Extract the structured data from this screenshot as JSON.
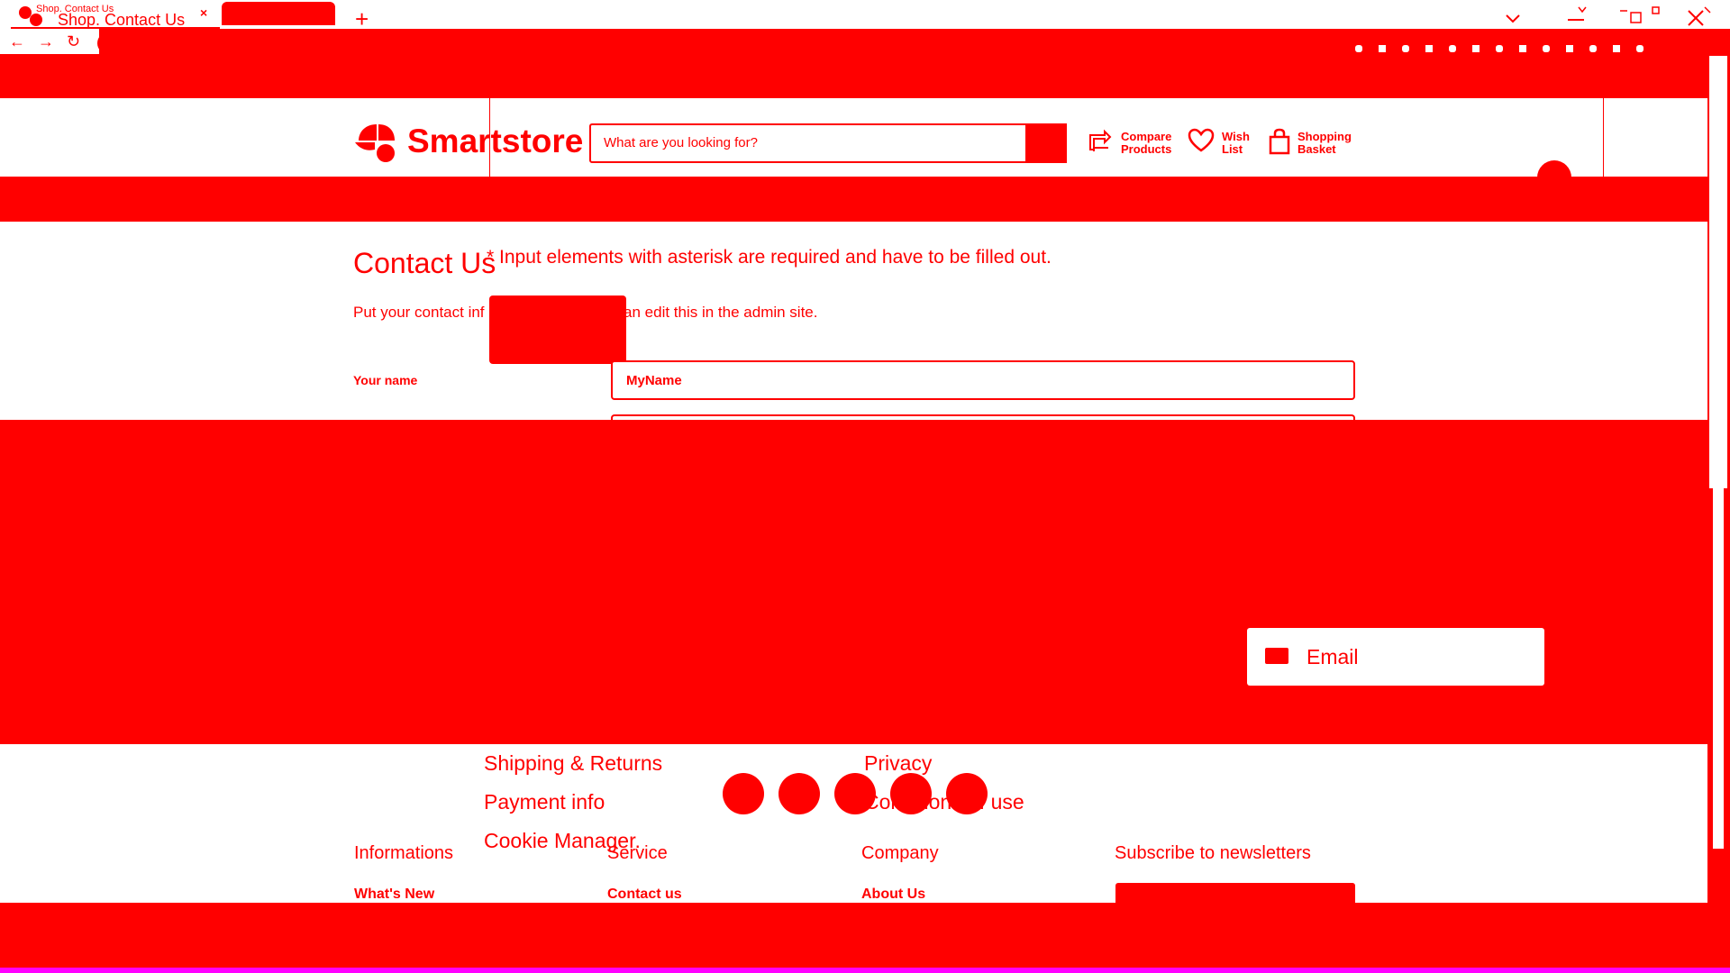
{
  "browser": {
    "tab_title_small": "Shop. Contact Us",
    "tab_title": "Shop. Contact Us",
    "tab_close": "×",
    "new_tab": "+",
    "back": "←",
    "forward": "→",
    "reload": "↻"
  },
  "header": {
    "logo_text": "Smartstore",
    "search_placeholder": "What are you looking for?",
    "compare_label_1": "Compare",
    "compare_label_2": "Products",
    "wish_label_1": "Wish",
    "wish_label_2": "List",
    "basket_label_1": "Shopping",
    "basket_label_2": "Basket"
  },
  "main": {
    "title": "Contact Us",
    "required_note": "* Input elements with asterisk are required and have to be filled out.",
    "intro_left": "Put your contact inf",
    "intro_right": "can edit this in the admin site.",
    "name_label": "Your name",
    "name_value": "MyName"
  },
  "email_card": {
    "label": "Email"
  },
  "footer": {
    "links_left": [
      "Shipping & Returns",
      "Payment info",
      "Cookie Manager."
    ],
    "links_right": [
      "Privacy",
      "Conditions of use"
    ],
    "columns": [
      {
        "heading": "Informations",
        "first_link": "What's New"
      },
      {
        "heading": "Service",
        "first_link": "Contact us"
      },
      {
        "heading": "Company",
        "first_link": "About Us"
      },
      {
        "heading": "Subscribe to newsletters",
        "first_link": ""
      }
    ]
  },
  "colors": {
    "primary": "#ff0000",
    "background": "#ffffff",
    "edge": "#ff00ff"
  }
}
